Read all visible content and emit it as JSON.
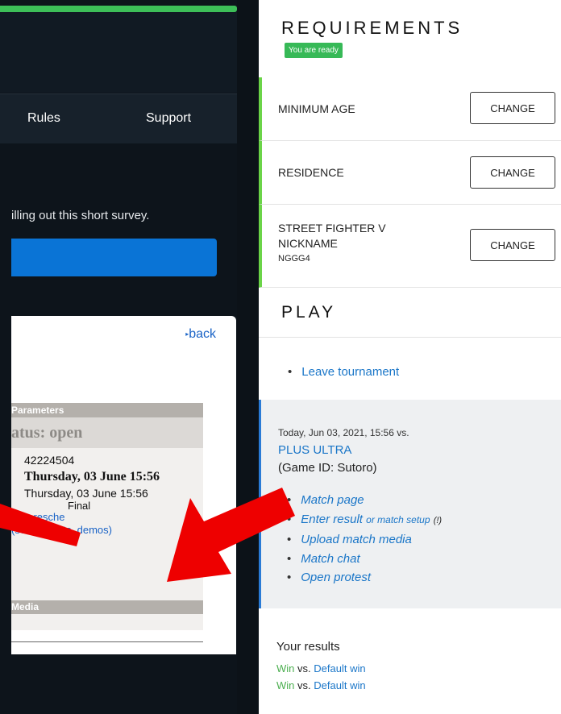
{
  "nav": {
    "rules": "Rules",
    "support": "Support"
  },
  "survey": {
    "text": "illing out this short survey."
  },
  "match_card": {
    "back": "back",
    "params_header": "Parameters",
    "status": "atus: open",
    "match_id": "42224504",
    "date_bold": "Thursday, 03 June 15:56",
    "date": "Thursday, 03 June 15:56",
    "round": "Final",
    "links": "sult, resche",
    "media_link": "(screenshots, demos)",
    "media_header": "Media"
  },
  "requirements": {
    "title": "REQUIREMENTS",
    "badge": "You are ready",
    "items": [
      {
        "label": "MINIMUM AGE",
        "button": "CHANGE"
      },
      {
        "label": "RESIDENCE",
        "button": "CHANGE"
      },
      {
        "label_line1": "STREET FIGHTER V",
        "label_line2": "NICKNAME",
        "value": "NGGG4",
        "button": "CHANGE"
      }
    ]
  },
  "play": {
    "title": "PLAY",
    "leave": "Leave tournament",
    "match": {
      "date": "Today, Jun 03, 2021, 15:56 vs.",
      "opponent": "PLUS ULTRA",
      "game_id": "(Game ID: Sutoro)",
      "links": {
        "match_page": "Match page",
        "enter_result": "Enter result",
        "or_setup": "or match setup",
        "warn": "(!)",
        "upload": "Upload match media",
        "chat": "Match chat",
        "protest": "Open protest"
      }
    }
  },
  "results": {
    "title": "Your results",
    "rows": [
      {
        "outcome": "Win",
        "vs": "vs.",
        "opponent": "Default win"
      },
      {
        "outcome": "Win",
        "vs": "vs.",
        "opponent": "Default win"
      }
    ]
  },
  "colors": {
    "accent_green": "#37b957",
    "link_blue": "#1a76c8",
    "arrow_red": "#ee0000",
    "survey_button": "#0a74d6"
  }
}
